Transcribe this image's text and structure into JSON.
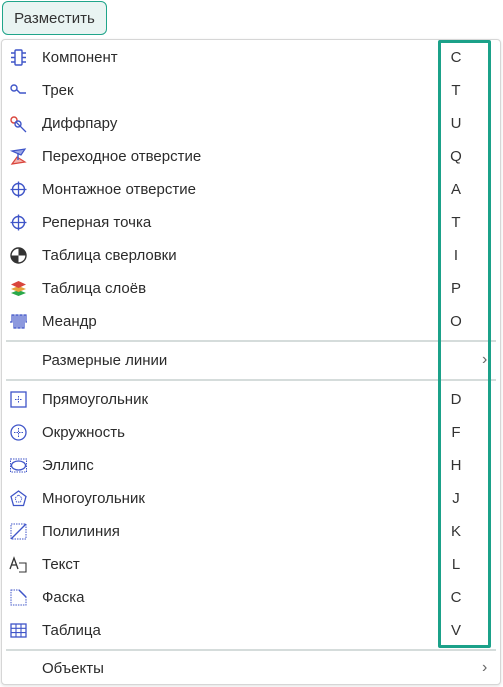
{
  "menu_button": {
    "label": "Разместить"
  },
  "items_top": [
    {
      "label": "Компонент",
      "shortcut": "C",
      "icon": "component-icon"
    },
    {
      "label": "Трек",
      "shortcut": "T",
      "icon": "track-icon"
    },
    {
      "label": "Диффпару",
      "shortcut": "U",
      "icon": "diffpair-icon"
    },
    {
      "label": "Переходное отверстие",
      "shortcut": "Q",
      "icon": "via-icon"
    },
    {
      "label": "Монтажное отверстие",
      "shortcut": "A",
      "icon": "mounting-hole-icon"
    },
    {
      "label": "Реперная точка",
      "shortcut": "T",
      "icon": "fiducial-icon"
    },
    {
      "label": "Таблица сверловки",
      "shortcut": "I",
      "icon": "drill-table-icon"
    },
    {
      "label": "Таблица слоёв",
      "shortcut": "P",
      "icon": "layer-table-icon"
    },
    {
      "label": "Меандр",
      "shortcut": "O",
      "icon": "meander-icon"
    }
  ],
  "submenu_dimensions": {
    "label": "Размерные линии",
    "chevron": "›"
  },
  "items_shapes": [
    {
      "label": "Прямоугольник",
      "shortcut": "D",
      "icon": "rectangle-icon"
    },
    {
      "label": "Окружность",
      "shortcut": "F",
      "icon": "circle-icon"
    },
    {
      "label": "Эллипс",
      "shortcut": "H",
      "icon": "ellipse-icon"
    },
    {
      "label": "Многоугольник",
      "shortcut": "J",
      "icon": "polygon-icon"
    },
    {
      "label": "Полилиния",
      "shortcut": "K",
      "icon": "polyline-icon"
    },
    {
      "label": "Текст",
      "shortcut": "L",
      "icon": "text-icon"
    },
    {
      "label": "Фаска",
      "shortcut": "C",
      "icon": "chamfer-icon"
    },
    {
      "label": "Таблица",
      "shortcut": "V",
      "icon": "table-icon"
    }
  ],
  "submenu_objects": {
    "label": "Объекты",
    "chevron": "›"
  },
  "colors": {
    "accent": "#1ba189",
    "icon_blue": "#3f55c8",
    "icon_red": "#d9453c",
    "icon_green": "#2aa84a"
  }
}
